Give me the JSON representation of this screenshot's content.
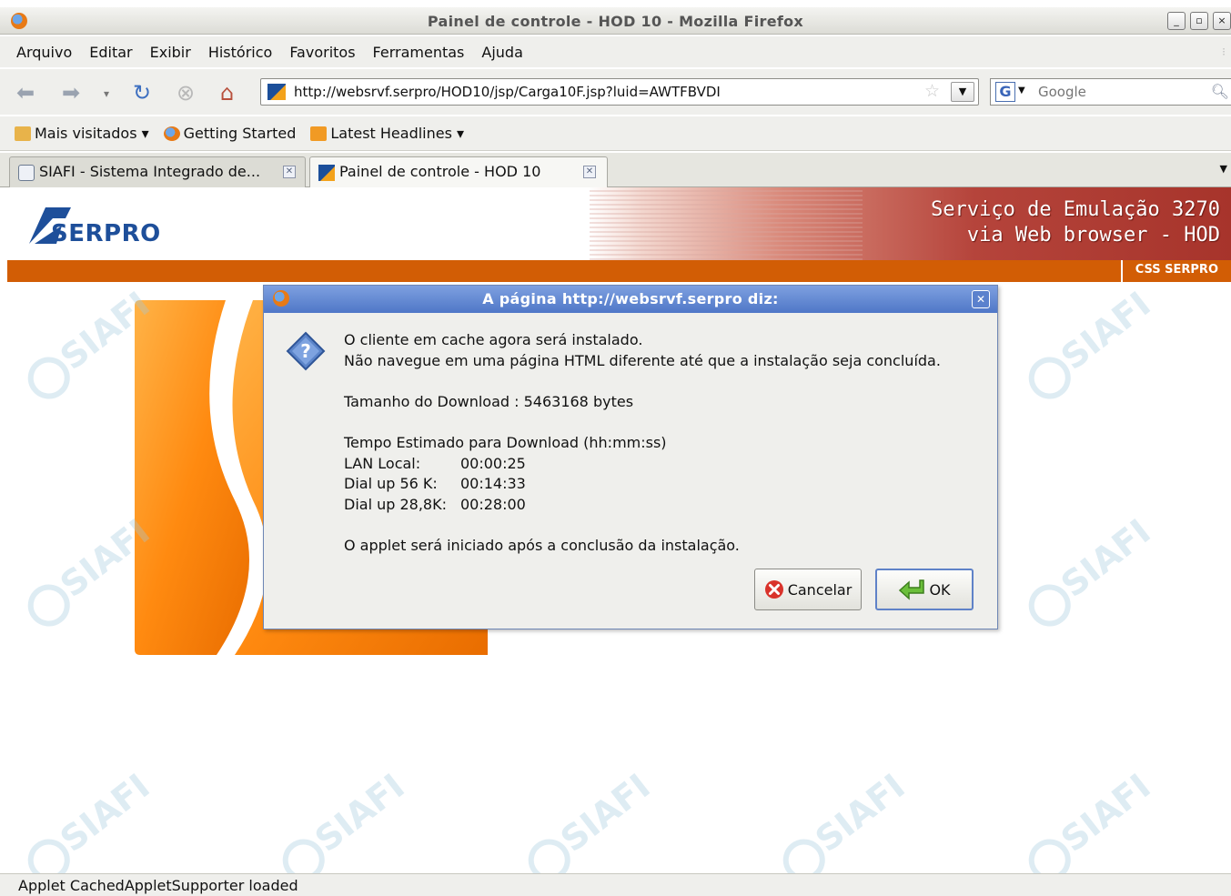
{
  "window": {
    "title": "Painel de controle - HOD 10 - Mozilla Firefox",
    "controls": [
      "_",
      "▫",
      "×"
    ]
  },
  "menu": [
    "Arquivo",
    "Editar",
    "Exibir",
    "Histórico",
    "Favoritos",
    "Ferramentas",
    "Ajuda"
  ],
  "nav": {
    "url": "http://websrvf.serpro/HOD10/jsp/Carga10F.jsp?luid=AWTFBVDI",
    "search_placeholder": "Google"
  },
  "bookmarks": [
    "Mais visitados ▾",
    "Getting Started",
    "Latest Headlines ▾"
  ],
  "tabs": [
    {
      "label": "SIAFI - Sistema Integrado de...",
      "active": false
    },
    {
      "label": "Painel de controle - HOD 10",
      "active": true
    }
  ],
  "page": {
    "logo_text": "SERPRO",
    "banner_line1": "Serviço de Emulação 3270",
    "banner_line2": "via Web browser - HOD",
    "css_tag": "CSS SERPRO",
    "watermark": "SIAFI"
  },
  "dialog": {
    "title": "A página http://websrvf.serpro diz:",
    "line1": "O cliente em cache agora será instalado.",
    "line2": "Não navegue em uma página HTML diferente até que a instalação seja concluída.",
    "download_size": "Tamanho do Download : 5463168 bytes",
    "time_header": "Tempo Estimado para Download (hh:mm:ss)",
    "times": [
      {
        "label": "LAN Local:",
        "value": "00:00:25"
      },
      {
        "label": "Dial up 56 K:",
        "value": "00:14:33"
      },
      {
        "label": "Dial up 28,8K:",
        "value": "00:28:00"
      }
    ],
    "footer": "O applet será iniciado após a conclusão da instalação.",
    "cancel_label": "Cancelar",
    "ok_label": "OK"
  },
  "status": "Applet CachedAppletSupporter loaded",
  "colors": {
    "orange": "#d25d05",
    "serpro_blue": "#1e4f9a",
    "dialog_title": "#5b81cd"
  }
}
